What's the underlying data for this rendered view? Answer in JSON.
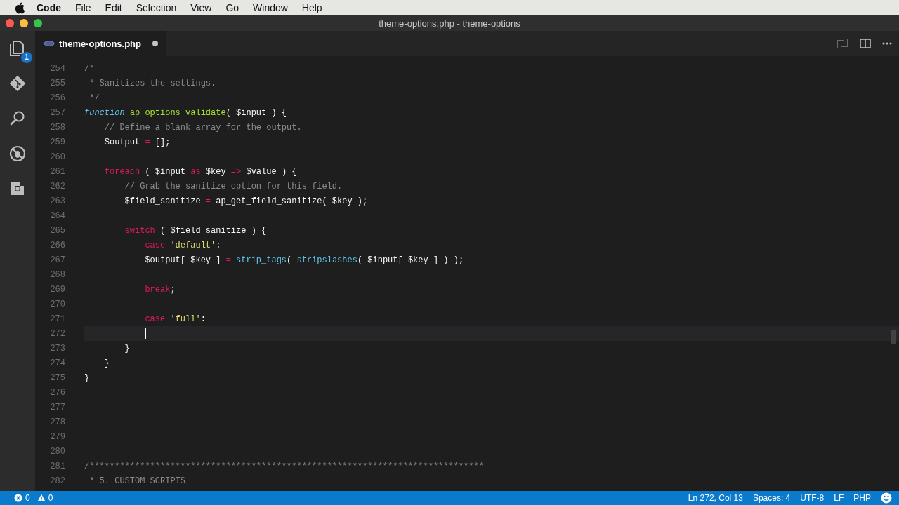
{
  "menu_bar": {
    "items": [
      {
        "label": "Code",
        "kind": "app"
      },
      {
        "label": "File",
        "kind": "menu"
      },
      {
        "label": "Edit",
        "kind": "menu"
      },
      {
        "label": "Selection",
        "kind": "menu"
      },
      {
        "label": "View",
        "kind": "menu"
      },
      {
        "label": "Go",
        "kind": "menu"
      },
      {
        "label": "Window",
        "kind": "menu"
      },
      {
        "label": "Help",
        "kind": "menu"
      }
    ]
  },
  "window": {
    "title": "theme-options.php - theme-options"
  },
  "activity_bar": {
    "items": [
      {
        "kind": "explorer",
        "badge": "1"
      },
      {
        "kind": "git"
      },
      {
        "kind": "search"
      },
      {
        "kind": "debug"
      },
      {
        "kind": "extensions"
      }
    ]
  },
  "tabs": [
    {
      "label": "theme-options.php",
      "selected": true,
      "modified": true
    }
  ],
  "editor": {
    "lines": [
      {
        "number": "254",
        "current": false,
        "tokens": [
          {
            "text": "/*",
            "kind": "comment"
          }
        ]
      },
      {
        "number": "255",
        "current": false,
        "tokens": [
          {
            "text": " * Sanitizes the settings.",
            "kind": "comment"
          }
        ]
      },
      {
        "number": "256",
        "current": false,
        "tokens": [
          {
            "text": " */",
            "kind": "comment"
          }
        ]
      },
      {
        "number": "257",
        "current": false,
        "tokens": [
          {
            "text": "function",
            "kind": "storage"
          },
          {
            "text": " ap_options_validate",
            "kind": "entity"
          },
          {
            "text": "( $input ) {",
            "kind": "plain"
          }
        ]
      },
      {
        "number": "258",
        "current": false,
        "tokens": [
          {
            "text": "    // Define a blank array for the output.",
            "kind": "comment"
          }
        ]
      },
      {
        "number": "259",
        "current": false,
        "tokens": [
          {
            "text": "    $output ",
            "kind": "plain"
          },
          {
            "text": "=",
            "kind": "operator"
          },
          {
            "text": " [];",
            "kind": "plain"
          }
        ]
      },
      {
        "number": "260",
        "current": false
      },
      {
        "number": "261",
        "current": false,
        "tokens": [
          {
            "text": "    foreach",
            "kind": "keyword"
          },
          {
            "text": " ( $input ",
            "kind": "plain"
          },
          {
            "text": "as",
            "kind": "keyword"
          },
          {
            "text": " $key ",
            "kind": "plain"
          },
          {
            "text": "=>",
            "kind": "operator"
          },
          {
            "text": " $value ) {",
            "kind": "plain"
          }
        ]
      },
      {
        "number": "262",
        "current": false,
        "tokens": [
          {
            "text": "        // Grab the sanitize option for this field.",
            "kind": "comment"
          }
        ]
      },
      {
        "number": "263",
        "current": false,
        "tokens": [
          {
            "text": "        $field_sanitize ",
            "kind": "plain"
          },
          {
            "text": "=",
            "kind": "operator"
          },
          {
            "text": " ap_get_field_sanitize( $key );",
            "kind": "plain"
          }
        ]
      },
      {
        "number": "264",
        "current": false
      },
      {
        "number": "265",
        "current": false,
        "tokens": [
          {
            "text": "        switch",
            "kind": "keyword"
          },
          {
            "text": " ( $field_sanitize ) {",
            "kind": "plain"
          }
        ]
      },
      {
        "number": "266",
        "current": false,
        "tokens": [
          {
            "text": "            case",
            "kind": "keyword"
          },
          {
            "text": " 'default'",
            "kind": "string"
          },
          {
            "text": ":",
            "kind": "plain"
          }
        ]
      },
      {
        "number": "267",
        "current": false,
        "tokens": [
          {
            "text": "            $output[ $key ] ",
            "kind": "plain"
          },
          {
            "text": "=",
            "kind": "operator"
          },
          {
            "text": " strip_tags",
            "kind": "support"
          },
          {
            "text": "( ",
            "kind": "plain"
          },
          {
            "text": "stripslashes",
            "kind": "support"
          },
          {
            "text": "( $input[ $key ] ) );",
            "kind": "plain"
          }
        ]
      },
      {
        "number": "268",
        "current": false
      },
      {
        "number": "269",
        "current": false,
        "tokens": [
          {
            "text": "            break",
            "kind": "keyword"
          },
          {
            "text": ";",
            "kind": "plain"
          }
        ]
      },
      {
        "number": "270",
        "current": false
      },
      {
        "number": "271",
        "current": false,
        "tokens": [
          {
            "text": "            case",
            "kind": "keyword"
          },
          {
            "text": " 'full'",
            "kind": "string"
          },
          {
            "text": ":",
            "kind": "plain"
          }
        ]
      },
      {
        "number": "272",
        "current": true
      },
      {
        "number": "273",
        "current": false,
        "tokens": [
          {
            "text": "        }",
            "kind": "plain"
          }
        ]
      },
      {
        "number": "274",
        "current": false,
        "tokens": [
          {
            "text": "    }",
            "kind": "plain"
          }
        ]
      },
      {
        "number": "275",
        "current": false,
        "tokens": [
          {
            "text": "}",
            "kind": "plain"
          }
        ]
      },
      {
        "number": "276",
        "current": false
      },
      {
        "number": "277",
        "current": false
      },
      {
        "number": "278",
        "current": false
      },
      {
        "number": "279",
        "current": false
      },
      {
        "number": "280",
        "current": false
      },
      {
        "number": "281",
        "current": false,
        "tokens": [
          {
            "text": "/******************************************************************************",
            "kind": "comment"
          }
        ]
      },
      {
        "number": "282",
        "current": false,
        "tokens": [
          {
            "text": " * 5. CUSTOM SCRIPTS",
            "kind": "comment"
          }
        ]
      }
    ]
  },
  "status_bar": {
    "errors": "0",
    "warnings": "0",
    "items": [
      "Ln 272, Col 13",
      "Spaces: 4",
      "UTF-8",
      "LF",
      "PHP"
    ]
  }
}
